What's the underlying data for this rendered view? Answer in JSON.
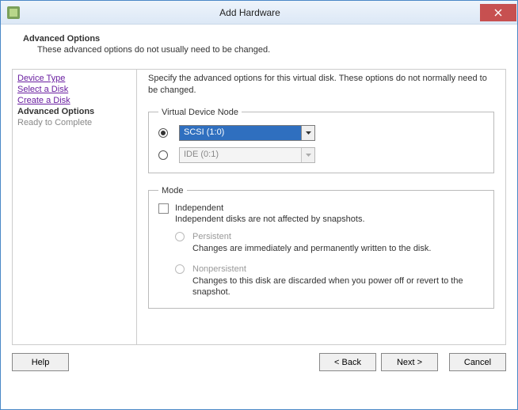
{
  "titlebar": {
    "title": "Add Hardware"
  },
  "header": {
    "title": "Advanced Options",
    "subtitle": "These advanced options do not usually need to be changed."
  },
  "sidebar": {
    "items": [
      {
        "label": "Device Type",
        "state": "done"
      },
      {
        "label": "Select a Disk",
        "state": "done"
      },
      {
        "label": "Create a Disk",
        "state": "done"
      },
      {
        "label": "Advanced Options",
        "state": "active"
      },
      {
        "label": "Ready to Complete",
        "state": "pending"
      }
    ]
  },
  "main": {
    "instruction": "Specify the advanced options for this virtual disk. These options do not normally need to be changed.",
    "deviceNode": {
      "legend": "Virtual Device Node",
      "scsi": "SCSI (1:0)",
      "ide": "IDE (0:1)"
    },
    "mode": {
      "legend": "Mode",
      "independent_label": "Independent",
      "independent_desc": "Independent disks are not affected by snapshots.",
      "persistent_label": "Persistent",
      "persistent_desc": "Changes are immediately and permanently written to the disk.",
      "nonpersistent_label": "Nonpersistent",
      "nonpersistent_desc": "Changes to this disk are discarded when you power off or revert to the snapshot."
    }
  },
  "footer": {
    "help": "Help",
    "back": "< Back",
    "next": "Next >",
    "cancel": "Cancel"
  }
}
